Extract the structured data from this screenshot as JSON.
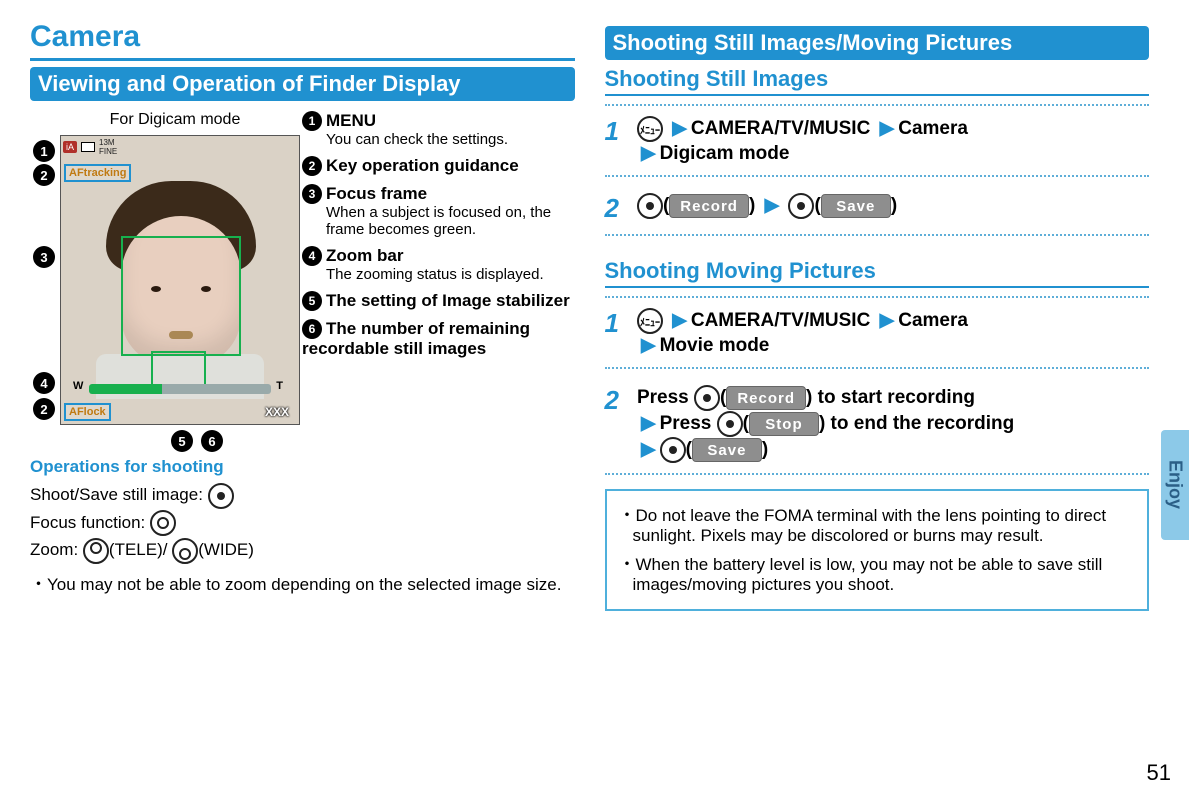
{
  "left": {
    "title": "Camera",
    "section": "Viewing and Operation of Finder Display",
    "finder_caption": "For Digicam mode",
    "af_tracking": "AFtracking",
    "af_lock": "AFlock",
    "xxx": "XXX",
    "callout_labels": [
      "1",
      "2",
      "3",
      "4",
      "5",
      "6"
    ],
    "legend": [
      {
        "title": "MENU",
        "desc": "You can check the settings."
      },
      {
        "title": "Key operation guidance",
        "desc": ""
      },
      {
        "title": "Focus frame",
        "desc": "When a subject is focused on, the frame becomes green."
      },
      {
        "title": "Zoom bar",
        "desc": "The zooming status is displayed."
      },
      {
        "title": "The setting of Image stabilizer",
        "desc": ""
      },
      {
        "title": "The number of remaining recordable still images",
        "desc": ""
      }
    ],
    "ops_heading": "Operations for shooting",
    "ops_shoot": "Shoot/Save still image: ",
    "ops_focus": "Focus function: ",
    "ops_zoom_prefix": "Zoom: ",
    "ops_zoom_tele": "(TELE)/",
    "ops_zoom_wide": "(WIDE)",
    "ops_note": "・You may not be able to zoom depending on the selected image size."
  },
  "right": {
    "section": "Shooting Still Images/Moving Pictures",
    "still_heading": "Shooting Still Images",
    "moving_heading": "Shooting Moving Pictures",
    "menu_key": "ﾒﾆｭｰ",
    "path_camera": "CAMERA/TV/MUSIC",
    "path_sub1": "Camera",
    "path_digicam": "Digicam mode",
    "path_movie": "Movie mode",
    "btn_record": "Record",
    "btn_save": "Save",
    "btn_stop": "Stop",
    "press_text": "Press ",
    "start_rec": " to start recording",
    "end_rec": " to end the recording",
    "warn": [
      "・Do not leave the FOMA terminal with the lens pointing to direct sunlight. Pixels may be discolored or burns may result.",
      "・When the battery level is low, you may not be able to save still images/moving pictures you shoot."
    ]
  },
  "sidetab": "Enjoy",
  "page_number": "51"
}
